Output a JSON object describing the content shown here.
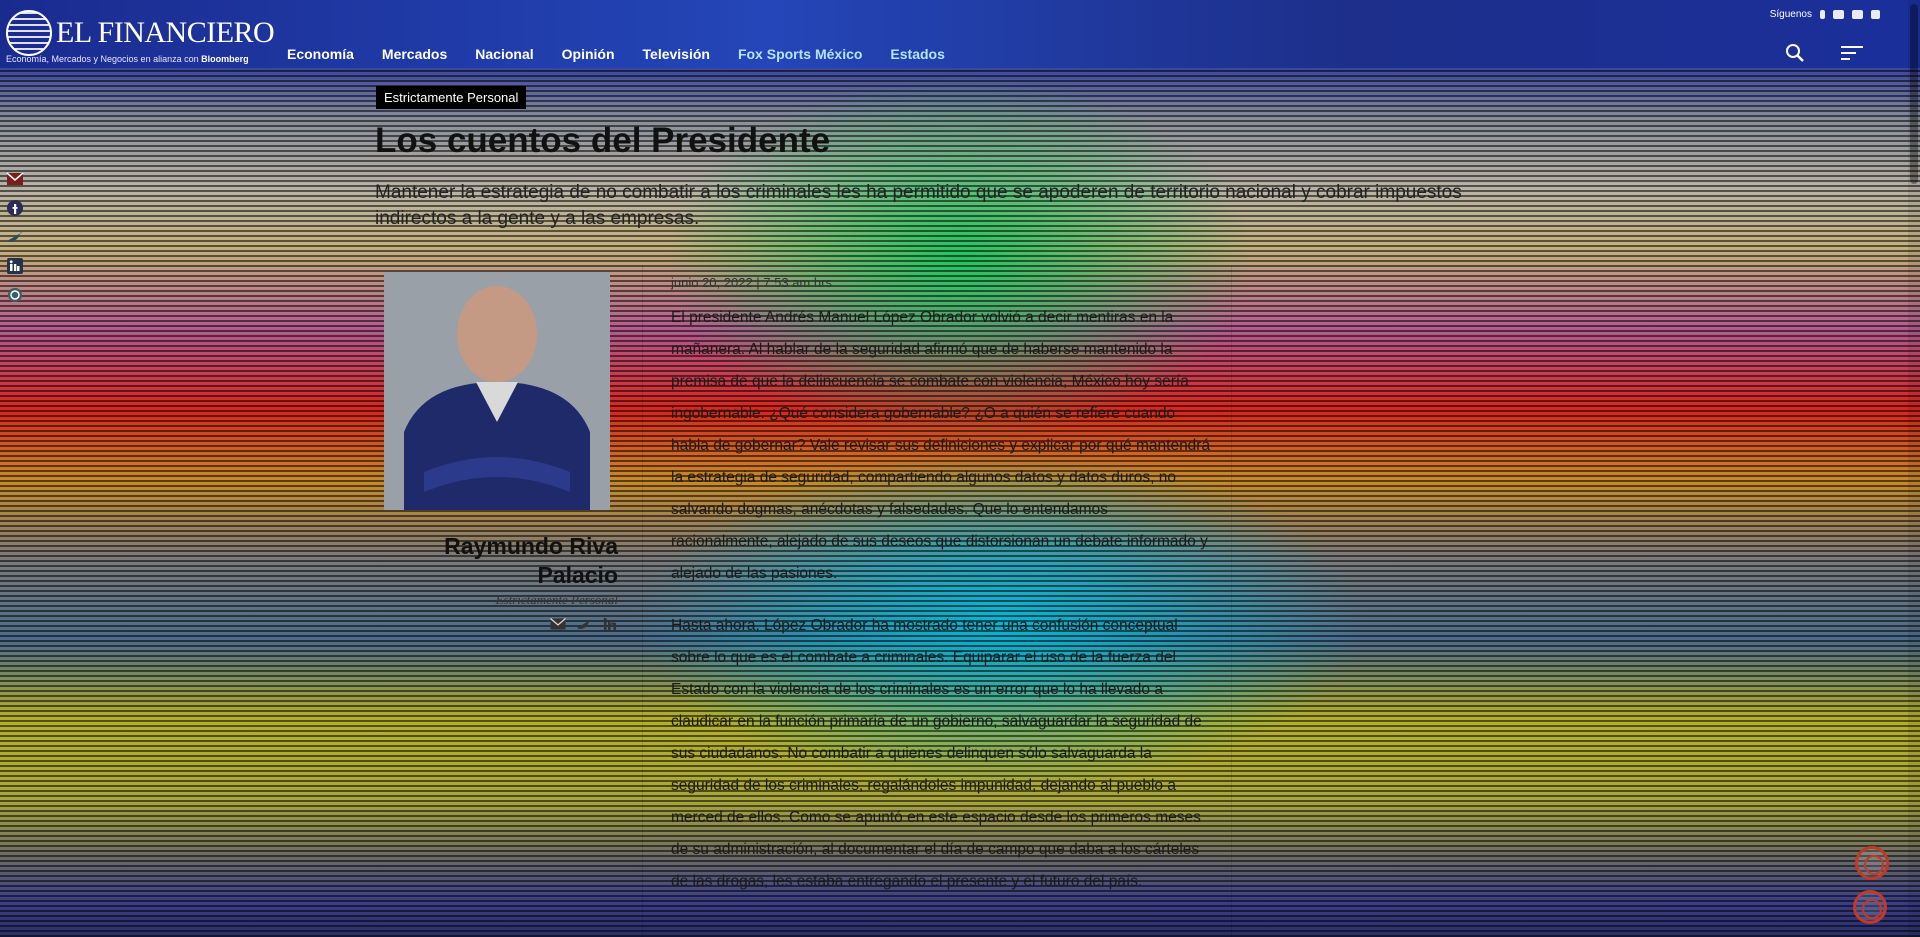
{
  "header": {
    "logo_name": "EL FINANCIERO",
    "logo_tagline_prefix": "Economía, Mercados y Negocios en alianza con",
    "logo_tagline_brand": "Bloomberg",
    "follow_label": "Síguenos",
    "nav": [
      "Economía",
      "Mercados",
      "Nacional",
      "Opinión",
      "Televisión",
      "Fox Sports México",
      "Estados"
    ],
    "icons": [
      "search-icon",
      "menu-icon"
    ]
  },
  "share_rail": [
    "email-icon",
    "facebook-icon",
    "twitter-icon",
    "linkedin-icon",
    "whatsapp-icon"
  ],
  "article": {
    "section": "Estrictamente Personal",
    "headline": "Los cuentos del Presidente",
    "standfirst": "Mantener la estrategia de no combatir a los criminales les ha permitido que se apoderen de territorio nacional y cobrar impuestos indirectos a la gente y a las empresas.",
    "dateline": "junio 20, 2022 | 7:53 am hrs",
    "paragraphs": [
      "El presidente Andrés Manuel López Obrador volvió a decir mentiras en la mañanera. Al hablar de la seguridad afirmó que de haberse mantenido la premisa de que la delincuencia se combate con violencia, México hoy sería ingobernable. ¿Qué considera gobernable? ¿O a quién se refiere cuando habla de gobernar? Vale revisar sus definiciones y explicar por qué mantendrá la estrategia de seguridad, compartiendo algunos datos y datos duros, no salvando dogmas, anécdotas y falsedades. Que lo entendamos racionalmente, alejado de sus deseos que distorsionan un debate informado y alejado de las pasiones.",
      "Hasta ahora, López Obrador ha mostrado tener una confusión conceptual sobre lo que es el combate a criminales. Equiparar el uso de la fuerza del Estado con la violencia de los criminales es un error que lo ha llevado a claudicar en la función primaria de un gobierno, salvaguardar la seguridad de sus ciudadanos. No combatir a quienes delinquen sólo salvaguarda la seguridad de los criminales, regalándoles impunidad, dejando al pueblo a merced de ellos. Como se apuntó en este espacio desde los primeros meses de su administración, al documentar el día de campo que daba a los cárteles de las drogas, les estaba entregando el presente y el futuro del país."
    ]
  },
  "author": {
    "name": "Raymundo Riva Palacio",
    "column": "Estrictamente Personal",
    "social": [
      "email-icon",
      "twitter-icon",
      "linkedin-icon"
    ]
  },
  "colors": {
    "header_blue": "#1e3aa8",
    "accent_red": "#c0392b",
    "tag_black": "#000000"
  }
}
